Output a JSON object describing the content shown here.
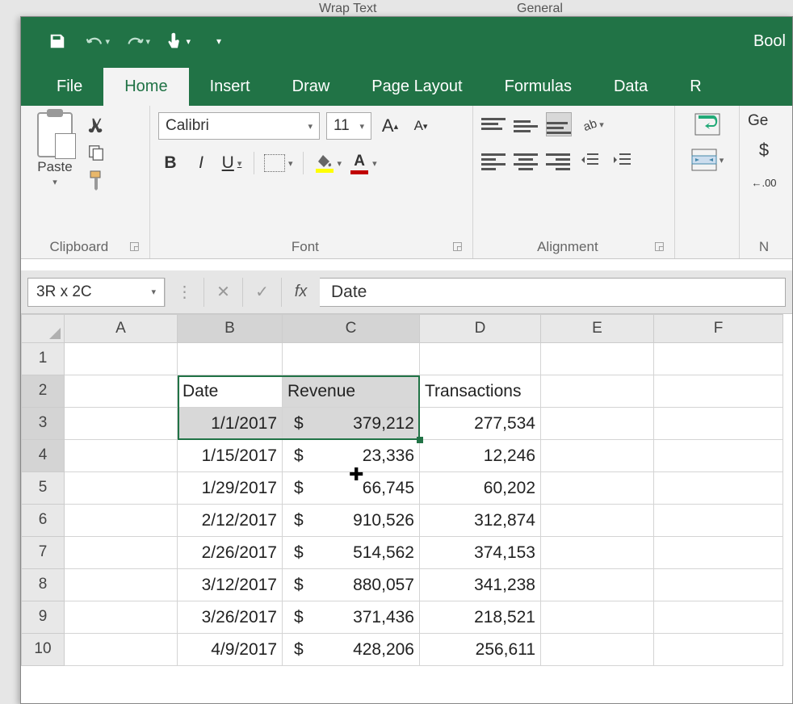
{
  "bg": {
    "wrap": "Wrap Text",
    "general": "General"
  },
  "title": "Bool",
  "tabs": {
    "file": "File",
    "home": "Home",
    "insert": "Insert",
    "draw": "Draw",
    "page_layout": "Page Layout",
    "formulas": "Formulas",
    "data": "Data",
    "review": "R"
  },
  "ribbon": {
    "clipboard": {
      "label": "Clipboard",
      "paste": "Paste"
    },
    "font": {
      "label": "Font",
      "name": "Calibri",
      "size": "11",
      "bold": "B",
      "italic": "I",
      "underline": "U",
      "fontcolor_letter": "A",
      "incA": "A",
      "decA": "A"
    },
    "alignment": {
      "label": "Alignment"
    },
    "number": {
      "label": "N",
      "format": "Ge",
      "currency": "$",
      "decimal": ".00"
    }
  },
  "fx": {
    "namebox": "3R x 2C",
    "fx": "fx",
    "formula": "Date"
  },
  "cols": [
    "A",
    "B",
    "C",
    "D",
    "E",
    "F"
  ],
  "rows": [
    "1",
    "2",
    "3",
    "4",
    "5",
    "6",
    "7",
    "8",
    "9",
    "10"
  ],
  "headers": {
    "b2": "Date",
    "c2": "Revenue",
    "d2": "Transactions"
  },
  "data": [
    {
      "date": "1/1/2017",
      "rev": "379,212",
      "tx": "277,534"
    },
    {
      "date": "1/15/2017",
      "rev": "23,336",
      "tx": "12,246"
    },
    {
      "date": "1/29/2017",
      "rev": "66,745",
      "tx": "60,202"
    },
    {
      "date": "2/12/2017",
      "rev": "910,526",
      "tx": "312,874"
    },
    {
      "date": "2/26/2017",
      "rev": "514,562",
      "tx": "374,153"
    },
    {
      "date": "3/12/2017",
      "rev": "880,057",
      "tx": "341,238"
    },
    {
      "date": "3/26/2017",
      "rev": "371,436",
      "tx": "218,521"
    },
    {
      "date": "4/9/2017",
      "rev": "428,206",
      "tx": "256,611"
    }
  ],
  "sym": {
    "dollar": "$"
  }
}
